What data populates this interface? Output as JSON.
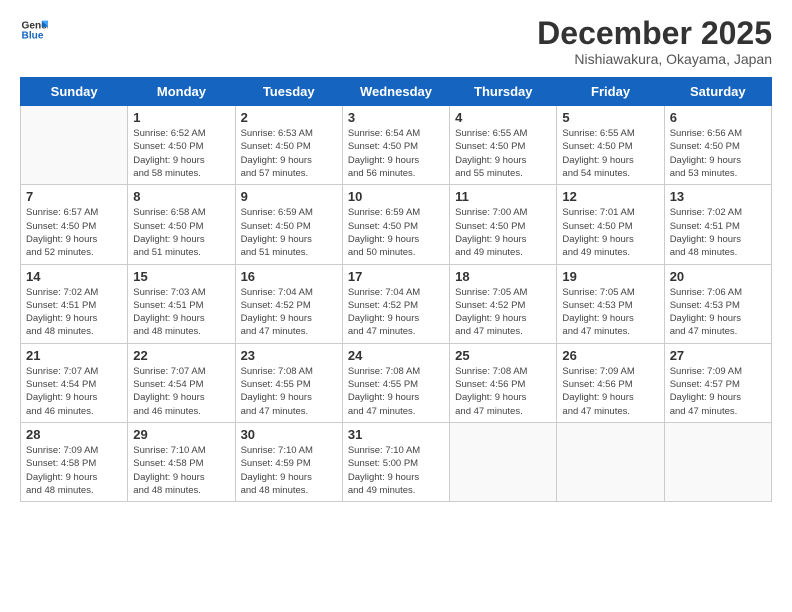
{
  "logo": {
    "line1": "General",
    "line2": "Blue"
  },
  "title": "December 2025",
  "location": "Nishiawakura, Okayama, Japan",
  "days_of_week": [
    "Sunday",
    "Monday",
    "Tuesday",
    "Wednesday",
    "Thursday",
    "Friday",
    "Saturday"
  ],
  "weeks": [
    [
      {
        "day": "",
        "info": ""
      },
      {
        "day": "1",
        "info": "Sunrise: 6:52 AM\nSunset: 4:50 PM\nDaylight: 9 hours\nand 58 minutes."
      },
      {
        "day": "2",
        "info": "Sunrise: 6:53 AM\nSunset: 4:50 PM\nDaylight: 9 hours\nand 57 minutes."
      },
      {
        "day": "3",
        "info": "Sunrise: 6:54 AM\nSunset: 4:50 PM\nDaylight: 9 hours\nand 56 minutes."
      },
      {
        "day": "4",
        "info": "Sunrise: 6:55 AM\nSunset: 4:50 PM\nDaylight: 9 hours\nand 55 minutes."
      },
      {
        "day": "5",
        "info": "Sunrise: 6:55 AM\nSunset: 4:50 PM\nDaylight: 9 hours\nand 54 minutes."
      },
      {
        "day": "6",
        "info": "Sunrise: 6:56 AM\nSunset: 4:50 PM\nDaylight: 9 hours\nand 53 minutes."
      }
    ],
    [
      {
        "day": "7",
        "info": "Sunrise: 6:57 AM\nSunset: 4:50 PM\nDaylight: 9 hours\nand 52 minutes."
      },
      {
        "day": "8",
        "info": "Sunrise: 6:58 AM\nSunset: 4:50 PM\nDaylight: 9 hours\nand 51 minutes."
      },
      {
        "day": "9",
        "info": "Sunrise: 6:59 AM\nSunset: 4:50 PM\nDaylight: 9 hours\nand 51 minutes."
      },
      {
        "day": "10",
        "info": "Sunrise: 6:59 AM\nSunset: 4:50 PM\nDaylight: 9 hours\nand 50 minutes."
      },
      {
        "day": "11",
        "info": "Sunrise: 7:00 AM\nSunset: 4:50 PM\nDaylight: 9 hours\nand 49 minutes."
      },
      {
        "day": "12",
        "info": "Sunrise: 7:01 AM\nSunset: 4:50 PM\nDaylight: 9 hours\nand 49 minutes."
      },
      {
        "day": "13",
        "info": "Sunrise: 7:02 AM\nSunset: 4:51 PM\nDaylight: 9 hours\nand 48 minutes."
      }
    ],
    [
      {
        "day": "14",
        "info": "Sunrise: 7:02 AM\nSunset: 4:51 PM\nDaylight: 9 hours\nand 48 minutes."
      },
      {
        "day": "15",
        "info": "Sunrise: 7:03 AM\nSunset: 4:51 PM\nDaylight: 9 hours\nand 48 minutes."
      },
      {
        "day": "16",
        "info": "Sunrise: 7:04 AM\nSunset: 4:52 PM\nDaylight: 9 hours\nand 47 minutes."
      },
      {
        "day": "17",
        "info": "Sunrise: 7:04 AM\nSunset: 4:52 PM\nDaylight: 9 hours\nand 47 minutes."
      },
      {
        "day": "18",
        "info": "Sunrise: 7:05 AM\nSunset: 4:52 PM\nDaylight: 9 hours\nand 47 minutes."
      },
      {
        "day": "19",
        "info": "Sunrise: 7:05 AM\nSunset: 4:53 PM\nDaylight: 9 hours\nand 47 minutes."
      },
      {
        "day": "20",
        "info": "Sunrise: 7:06 AM\nSunset: 4:53 PM\nDaylight: 9 hours\nand 47 minutes."
      }
    ],
    [
      {
        "day": "21",
        "info": "Sunrise: 7:07 AM\nSunset: 4:54 PM\nDaylight: 9 hours\nand 46 minutes."
      },
      {
        "day": "22",
        "info": "Sunrise: 7:07 AM\nSunset: 4:54 PM\nDaylight: 9 hours\nand 46 minutes."
      },
      {
        "day": "23",
        "info": "Sunrise: 7:08 AM\nSunset: 4:55 PM\nDaylight: 9 hours\nand 47 minutes."
      },
      {
        "day": "24",
        "info": "Sunrise: 7:08 AM\nSunset: 4:55 PM\nDaylight: 9 hours\nand 47 minutes."
      },
      {
        "day": "25",
        "info": "Sunrise: 7:08 AM\nSunset: 4:56 PM\nDaylight: 9 hours\nand 47 minutes."
      },
      {
        "day": "26",
        "info": "Sunrise: 7:09 AM\nSunset: 4:56 PM\nDaylight: 9 hours\nand 47 minutes."
      },
      {
        "day": "27",
        "info": "Sunrise: 7:09 AM\nSunset: 4:57 PM\nDaylight: 9 hours\nand 47 minutes."
      }
    ],
    [
      {
        "day": "28",
        "info": "Sunrise: 7:09 AM\nSunset: 4:58 PM\nDaylight: 9 hours\nand 48 minutes."
      },
      {
        "day": "29",
        "info": "Sunrise: 7:10 AM\nSunset: 4:58 PM\nDaylight: 9 hours\nand 48 minutes."
      },
      {
        "day": "30",
        "info": "Sunrise: 7:10 AM\nSunset: 4:59 PM\nDaylight: 9 hours\nand 48 minutes."
      },
      {
        "day": "31",
        "info": "Sunrise: 7:10 AM\nSunset: 5:00 PM\nDaylight: 9 hours\nand 49 minutes."
      },
      {
        "day": "",
        "info": ""
      },
      {
        "day": "",
        "info": ""
      },
      {
        "day": "",
        "info": ""
      }
    ]
  ]
}
